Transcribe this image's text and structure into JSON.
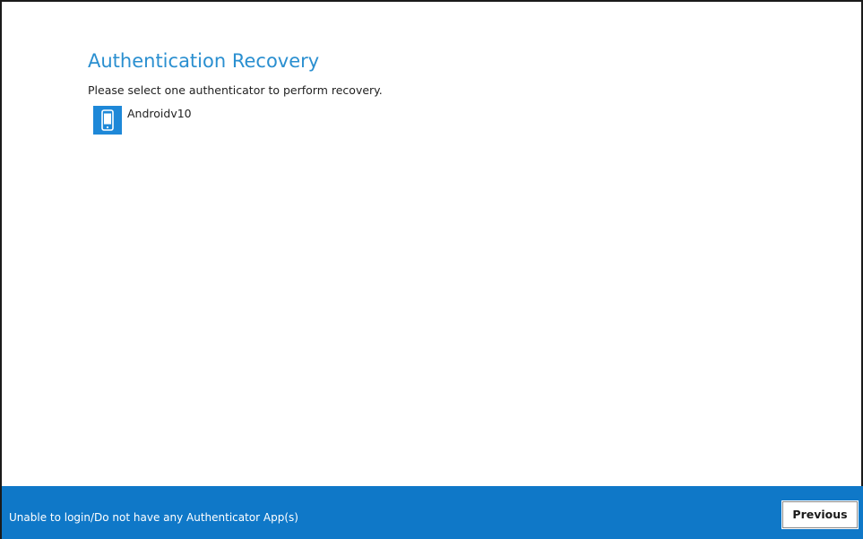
{
  "page": {
    "title": "Authentication Recovery",
    "instruction": "Please select one authenticator to perform recovery."
  },
  "authenticators": [
    {
      "name": "Androidv10",
      "icon": "mobile-phone-icon"
    }
  ],
  "footer": {
    "help_link": "Unable to login/Do not have any Authenticator App(s)",
    "previous_label": "Previous"
  },
  "colors": {
    "title": "#2a8fd0",
    "footer_background": "#0f78c8",
    "icon_background": "#1e88d8"
  }
}
